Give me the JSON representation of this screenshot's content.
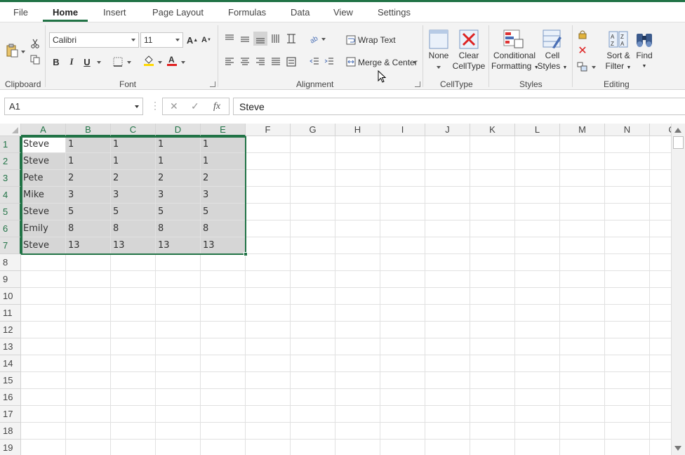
{
  "menu": {
    "tabs": [
      "File",
      "Home",
      "Insert",
      "Page Layout",
      "Formulas",
      "Data",
      "View",
      "Settings"
    ],
    "active": "Home"
  },
  "ribbon": {
    "groups": {
      "clipboard": "Clipboard",
      "font": "Font",
      "alignment": "Alignment",
      "celltype": "CellType",
      "styles": "Styles",
      "editing": "Editing"
    },
    "font_name": "Calibri",
    "font_size": "11",
    "wrap_text": "Wrap Text",
    "merge_center": "Merge & Center",
    "bold": "B",
    "italic": "I",
    "underline": "U",
    "celltype_none": "None",
    "clear_celltype_1": "Clear",
    "clear_celltype_2": "CellType",
    "conditional_1": "Conditional",
    "conditional_2": "Formatting",
    "cell_styles_1": "Cell",
    "cell_styles_2": "Styles",
    "sort_filter_1": "Sort &",
    "sort_filter_2": "Filter",
    "find": "Find",
    "colors": {
      "fill": "#ffd800",
      "font": "#e02020",
      "accent": "#217346"
    }
  },
  "formula_bar": {
    "name_box": "A1",
    "fx": "fx",
    "value": "Steve"
  },
  "sheet": {
    "columns": [
      "A",
      "B",
      "C",
      "D",
      "E",
      "F",
      "G",
      "H",
      "I",
      "J",
      "K",
      "L",
      "M",
      "N",
      "O"
    ],
    "rows": [
      "1",
      "2",
      "3",
      "4",
      "5",
      "6",
      "7",
      "8",
      "9",
      "10",
      "11",
      "12",
      "13",
      "14",
      "15",
      "16",
      "17",
      "18",
      "19"
    ],
    "data": [
      [
        "Steve",
        "1",
        "1",
        "1",
        "1"
      ],
      [
        "Steve",
        "1",
        "1",
        "1",
        "1"
      ],
      [
        "Pete",
        "2",
        "2",
        "2",
        "2"
      ],
      [
        "Mike",
        "3",
        "3",
        "3",
        "3"
      ],
      [
        "Steve",
        "5",
        "5",
        "5",
        "5"
      ],
      [
        "Emily",
        "8",
        "8",
        "8",
        "8"
      ],
      [
        "Steve",
        "13",
        "13",
        "13",
        "13"
      ]
    ],
    "selection": "A1:E7"
  }
}
